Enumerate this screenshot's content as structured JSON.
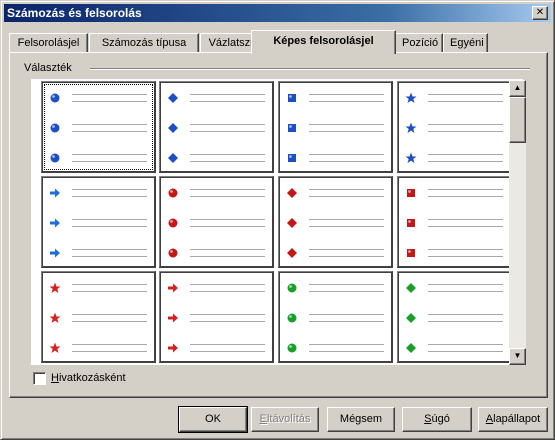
{
  "window": {
    "title": "Számozás és felsorolás",
    "close_label": "✕"
  },
  "tabs": [
    {
      "label": "Felsorolásjel",
      "active": false
    },
    {
      "label": "Számozás típusa",
      "active": false
    },
    {
      "label": "Vázlatszintek",
      "active": false
    },
    {
      "label": "Képes felsorolásjel",
      "active": true
    },
    {
      "label": "Pozíció",
      "active": false
    },
    {
      "label": "Egyéni",
      "active": false
    }
  ],
  "selection": {
    "group_label": "Választék",
    "selected_index": 0,
    "items": [
      {
        "shape": "sphere",
        "color": "#1d4fc4"
      },
      {
        "shape": "diamond",
        "color": "#1d4fc4"
      },
      {
        "shape": "cube",
        "color": "#1d4fc4"
      },
      {
        "shape": "star",
        "color": "#1d4fc4"
      },
      {
        "shape": "arrow",
        "color": "#1d6fd8"
      },
      {
        "shape": "sphere",
        "color": "#c41818"
      },
      {
        "shape": "diamond",
        "color": "#c41818"
      },
      {
        "shape": "cube",
        "color": "#c41818"
      },
      {
        "shape": "star",
        "color": "#d42020"
      },
      {
        "shape": "arrow",
        "color": "#d42020"
      },
      {
        "shape": "sphere",
        "color": "#18a028"
      },
      {
        "shape": "diamond",
        "color": "#18a028"
      }
    ]
  },
  "link_checkbox": {
    "label_first": "H",
    "label_rest": "ivatkozásként",
    "checked": false
  },
  "buttons": {
    "ok": {
      "label": "OK"
    },
    "remove": {
      "label_first": "E",
      "label_rest": "ltávolítás",
      "disabled": true
    },
    "cancel": {
      "label": "Mégsem"
    },
    "help": {
      "label_first": "S",
      "label_rest": "úgó"
    },
    "reset": {
      "label_first": "A",
      "label_rest": "lapállapot"
    }
  },
  "scrollbar": {
    "up_icon": "▲",
    "down_icon": "▼"
  }
}
